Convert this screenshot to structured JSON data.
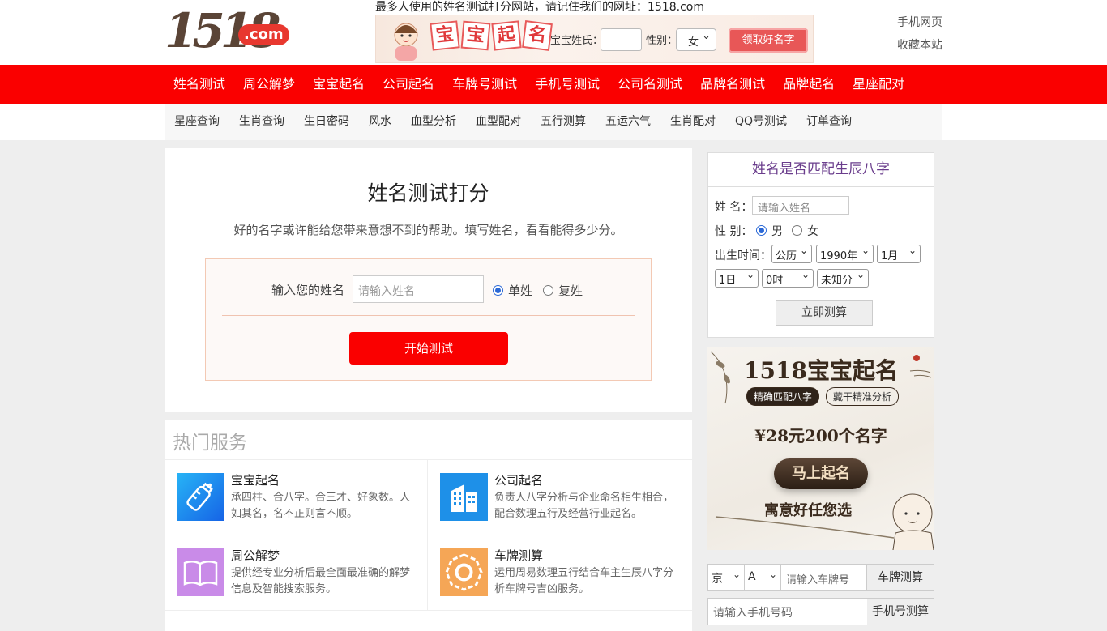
{
  "header": {
    "logo_number": "1518",
    "logo_suffix": ".com",
    "slogan": "最多人使用的姓名测试打分网站，请记住我们的网址：1518.com",
    "banner": {
      "title_chars": [
        "宝",
        "宝",
        "起",
        "名"
      ],
      "surname_label": "宝宝姓氏：",
      "gender_label": "性别：",
      "gender_value": "女",
      "cta": "领取好名字"
    },
    "links": [
      "手机网页",
      "收藏本站"
    ]
  },
  "nav": [
    "姓名测试",
    "周公解梦",
    "宝宝起名",
    "公司起名",
    "车牌号测试",
    "手机号测试",
    "公司名测试",
    "品牌名测试",
    "品牌起名",
    "星座配对"
  ],
  "subnav": [
    "星座查询",
    "生肖查询",
    "生日密码",
    "风水",
    "血型分析",
    "血型配对",
    "五行测算",
    "五运六气",
    "生肖配对",
    "QQ号测试",
    "订单查询"
  ],
  "test": {
    "title": "姓名测试打分",
    "desc": "好的名字或许能给您带来意想不到的帮助。填写姓名，看看能得多少分。",
    "name_label": "输入您的姓名",
    "name_placeholder": "请输入姓名",
    "opt_single": "单姓",
    "opt_double": "复姓",
    "submit": "开始测试"
  },
  "hot": {
    "title": "热门服务",
    "items": [
      {
        "title": "宝宝起名",
        "desc": "承四柱、合八字。合三才、好象数。人如其名，名不正则言不顺。",
        "icon": "baby-bottle-icon",
        "color": "#1e8ef0"
      },
      {
        "title": "公司起名",
        "desc": "负责人八字分析与企业命名相生相合，配合数理五行及经营行业起名。",
        "icon": "building-icon",
        "color": "#1e90e8"
      },
      {
        "title": "周公解梦",
        "desc": "提供经专业分析后最全面最准确的解梦信息及智能搜索服务。",
        "icon": "book-icon",
        "color": "#c98be8"
      },
      {
        "title": "车牌测算",
        "desc": "运用周易数理五行结合车主生辰八字分析车牌号吉凶服务。",
        "icon": "bagua-icon",
        "color": "#f5a656"
      }
    ]
  },
  "match": {
    "title": "姓名是否匹配生辰八字",
    "name_label": "姓 名：",
    "name_placeholder": "请输入姓名",
    "gender_label": "性 别：",
    "male": "男",
    "female": "女",
    "birth_label": "出生时间：",
    "calendar": "公历",
    "year": "1990年",
    "month": "1月",
    "day": "1日",
    "hour": "0时",
    "minute": "未知分",
    "submit": "立即测算"
  },
  "ad": {
    "title": "1518宝宝起名",
    "tag1": "精确匹配八字",
    "tag2": "藏干精准分析",
    "price": "¥28元200个名字",
    "cta": "马上起名",
    "slogan": "寓意好任您选"
  },
  "plate": {
    "province": "京",
    "letter": "A",
    "placeholder": "请输入车牌号",
    "submit": "车牌测算"
  },
  "phone": {
    "placeholder": "请输入手机号码",
    "submit": "手机号测算"
  }
}
